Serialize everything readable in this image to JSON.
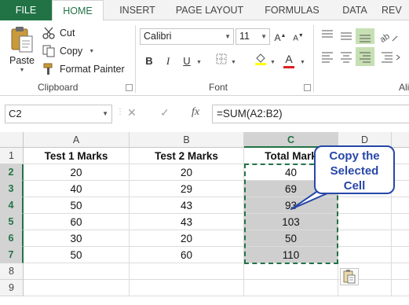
{
  "tabs": [
    "FILE",
    "HOME",
    "INSERT",
    "PAGE LAYOUT",
    "FORMULAS",
    "DATA",
    "REV"
  ],
  "active_tab": "HOME",
  "ribbon": {
    "clipboard": {
      "paste": "Paste",
      "cut": "Cut",
      "copy": "Copy",
      "format_painter": "Format Painter",
      "group_label": "Clipboard"
    },
    "font": {
      "family": "Calibri",
      "size": "11",
      "bold": "B",
      "italic": "I",
      "underline": "U",
      "font_color_glyph": "A",
      "group_label": "Font"
    },
    "alignment": {
      "group_label": "Ali"
    }
  },
  "formula_bar": {
    "name_box": "C2",
    "formula": "=SUM(A2:B2)",
    "cancel_glyph": "✕",
    "enter_glyph": "✓",
    "fx": "fx"
  },
  "grid": {
    "columns": [
      "A",
      "B",
      "C",
      "D"
    ],
    "rows": [
      "1",
      "2",
      "3",
      "4",
      "5",
      "6",
      "7",
      "8",
      "9"
    ],
    "headers": [
      "Test 1 Marks",
      "Test 2 Marks",
      "Total Mark"
    ],
    "data": [
      [
        "20",
        "20",
        "40"
      ],
      [
        "40",
        "29",
        "69"
      ],
      [
        "50",
        "43",
        "93"
      ],
      [
        "60",
        "43",
        "103"
      ],
      [
        "30",
        "20",
        "50"
      ],
      [
        "50",
        "60",
        "110"
      ]
    ],
    "selected_column": "C"
  },
  "callout": {
    "line1": "Copy the",
    "line2": "Selected",
    "line3": "Cell"
  },
  "colors": {
    "excel_green": "#217346",
    "callout_blue": "#2747a8",
    "selection_fill": "#cfcfcf"
  }
}
